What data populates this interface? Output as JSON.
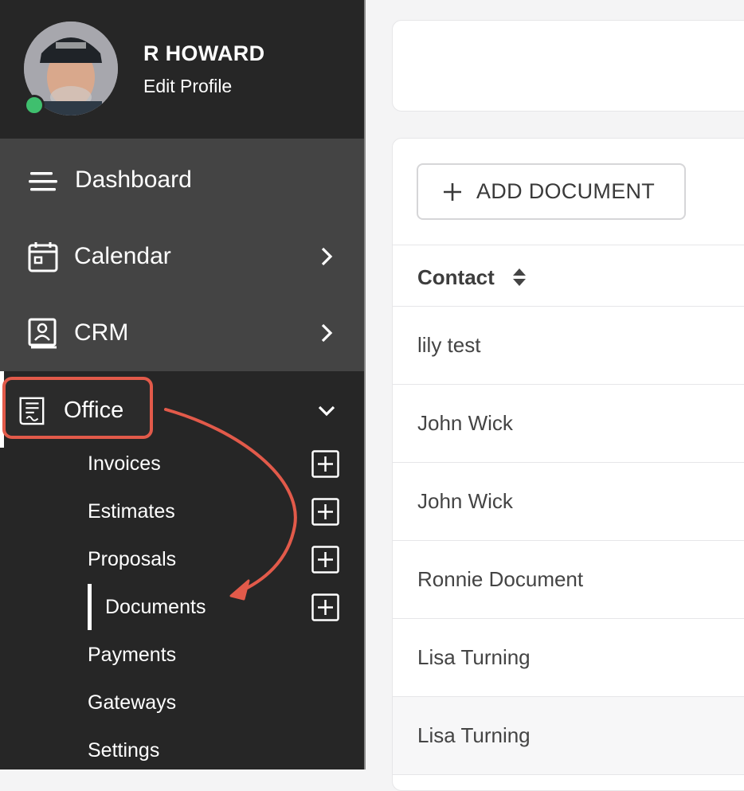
{
  "profile": {
    "name": "R HOWARD",
    "edit_label": "Edit Profile",
    "status_color": "#3fbf6e"
  },
  "nav": {
    "dashboard": "Dashboard",
    "calendar": "Calendar",
    "crm": "CRM",
    "office": "Office"
  },
  "office_menu": [
    {
      "label": "Invoices",
      "has_add": true
    },
    {
      "label": "Estimates",
      "has_add": true
    },
    {
      "label": "Proposals",
      "has_add": true
    },
    {
      "label": "Documents",
      "has_add": true,
      "active": true
    },
    {
      "label": "Payments"
    },
    {
      "label": "Gateways"
    },
    {
      "label": "Settings"
    }
  ],
  "toolbar": {
    "add_document": "ADD DOCUMENT"
  },
  "table": {
    "column_contact": "Contact",
    "rows": [
      "lily test",
      "John Wick",
      "John Wick",
      "Ronnie Document",
      "Lisa Turning",
      "Lisa Turning"
    ]
  },
  "colors": {
    "sidebar_bg": "#262626",
    "nav_bg": "#444444",
    "annotation": "#e25a4a"
  },
  "icons": {
    "dashboard": "menu-lines-icon",
    "calendar": "calendar-icon",
    "crm": "contact-book-icon",
    "office": "receipt-icon"
  }
}
